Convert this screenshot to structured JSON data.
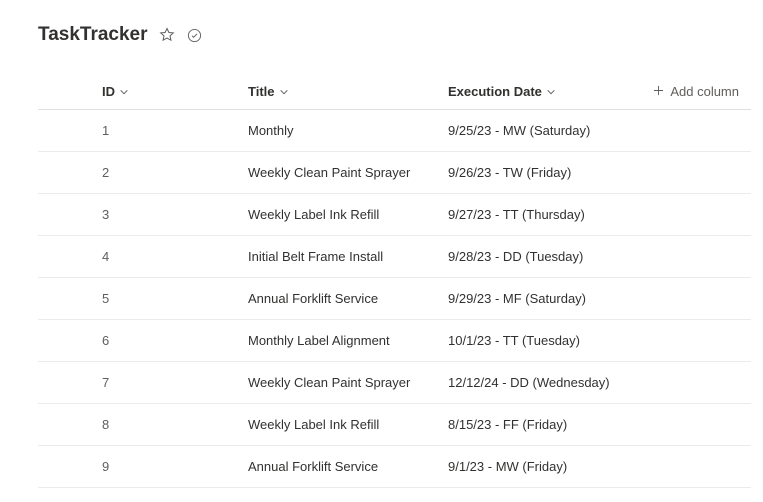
{
  "header": {
    "title": "TaskTracker"
  },
  "columns": {
    "id": "ID",
    "title": "Title",
    "execution_date": "Execution Date",
    "add": "Add column"
  },
  "rows": [
    {
      "id": "1",
      "title": "Monthly",
      "execution_date": "9/25/23 - MW (Saturday)"
    },
    {
      "id": "2",
      "title": "Weekly Clean Paint Sprayer",
      "execution_date": "9/26/23 - TW (Friday)"
    },
    {
      "id": "3",
      "title": "Weekly Label Ink Refill",
      "execution_date": "9/27/23 - TT (Thursday)"
    },
    {
      "id": "4",
      "title": "Initial Belt Frame Install",
      "execution_date": "9/28/23 - DD (Tuesday)"
    },
    {
      "id": "5",
      "title": "Annual Forklift Service",
      "execution_date": "9/29/23 - MF (Saturday)"
    },
    {
      "id": "6",
      "title": "Monthly Label Alignment",
      "execution_date": "10/1/23 - TT (Tuesday)"
    },
    {
      "id": "7",
      "title": "Weekly Clean Paint Sprayer",
      "execution_date": "12/12/24 - DD (Wednesday)"
    },
    {
      "id": "8",
      "title": "Weekly Label Ink Refill",
      "execution_date": "8/15/23 - FF (Friday)"
    },
    {
      "id": "9",
      "title": "Annual Forklift Service",
      "execution_date": "9/1/23 - MW (Friday)"
    }
  ]
}
